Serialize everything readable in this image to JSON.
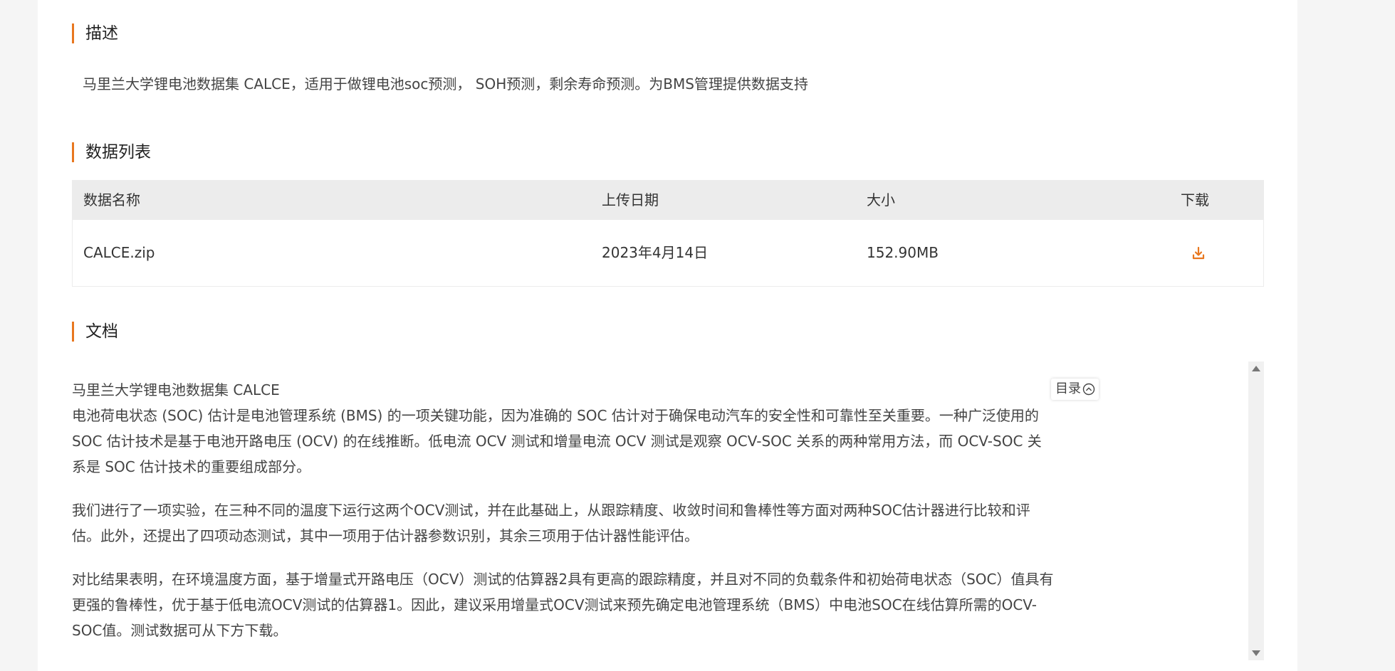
{
  "sections": {
    "description": {
      "title": "描述",
      "text": "马里兰大学锂电池数据集 CALCE，适用于做锂电池soc预测， SOH预测，剩余寿命预测。为BMS管理提供数据支持"
    },
    "data_list": {
      "title": "数据列表",
      "columns": [
        "数据名称",
        "上传日期",
        "大小",
        "下载"
      ],
      "rows": [
        {
          "name": "CALCE.zip",
          "date": "2023年4月14日",
          "size": "152.90MB",
          "download_icon": "download-icon"
        }
      ]
    },
    "documents": {
      "title": "文档",
      "toc_label": "目录",
      "paragraphs": [
        "马里兰大学锂电池数据集 CALCE",
        "电池荷电状态 (SOC) 估计是电池管理系统 (BMS) 的一项关键功能，因为准确的 SOC 估计对于确保电动汽车的安全性和可靠性至关重要。一种广泛使用的 SOC 估计技术是基于电池开路电压 (OCV) 的在线推断。低电流 OCV 测试和增量电流 OCV 测试是观察 OCV-SOC 关系的两种常用方法，而 OCV-SOC 关系是 SOC 估计技术的重要组成部分。",
        "我们进行了一项实验，在三种不同的温度下运行这两个OCV测试，并在此基础上，从跟踪精度、收敛时间和鲁棒性等方面对两种SOC估计器进行比较和评估。此外，还提出了四项动态测试，其中一项用于估计器参数识别，其余三项用于估计器性能评估。",
        "对比结果表明，在环境温度方面，基于增量式开路电压（OCV）测试的估算器2具有更高的跟踪精度，并且对不同的负载条件和初始荷电状态（SOC）值具有更强的鲁棒性，优于基于低电流OCV测试的估算器1。因此，建议采用增量式OCV测试来预先确定电池管理系统（BMS）中电池SOC在线估算所需的OCV-SOC值。测试数据可从下方下载。"
      ]
    }
  },
  "colors": {
    "accent": "#e8771f",
    "header_bg": "#ececec",
    "page_bg": "#f5f5f5",
    "panel_bg": "#ffffff"
  }
}
